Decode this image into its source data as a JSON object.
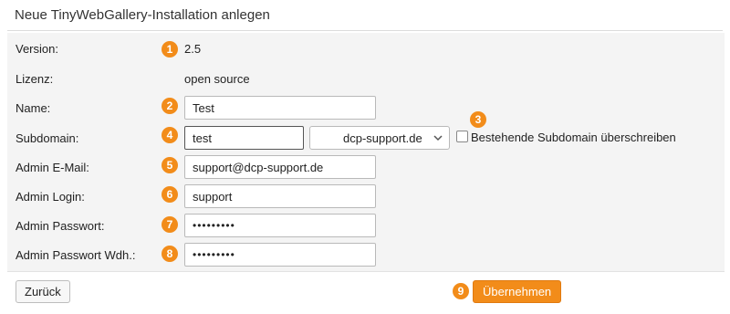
{
  "page": {
    "title": "Neue TinyWebGallery-Installation anlegen"
  },
  "form": {
    "version": {
      "label": "Version:",
      "value": "2.5",
      "badge": "1"
    },
    "lizenz": {
      "label": "Lizenz:",
      "value": "open source"
    },
    "name": {
      "label": "Name:",
      "value": "Test",
      "badge": "2"
    },
    "subdomain": {
      "label": "Subdomain:",
      "value": "test",
      "badge": "4",
      "domain_selected": "dcp-support.de",
      "chevron_icon": "chevron-down-icon",
      "overwrite_badge": "3",
      "overwrite_label": "Bestehende Subdomain überschreiben",
      "overwrite_checked": false
    },
    "admin_email": {
      "label": "Admin E-Mail:",
      "value": "support@dcp-support.de",
      "badge": "5"
    },
    "admin_login": {
      "label": "Admin Login:",
      "value": "support",
      "badge": "6"
    },
    "admin_password": {
      "label": "Admin Passwort:",
      "value": "•••••••••",
      "badge": "7"
    },
    "admin_password_repeat": {
      "label": "Admin Passwort Wdh.:",
      "value": "•••••••••",
      "badge": "8"
    }
  },
  "actions": {
    "back_label": "Zurück",
    "submit_label": "Übernehmen",
    "submit_badge": "9"
  },
  "colors": {
    "accent": "#f28c1a",
    "panel_bg": "#f4f4f4"
  }
}
